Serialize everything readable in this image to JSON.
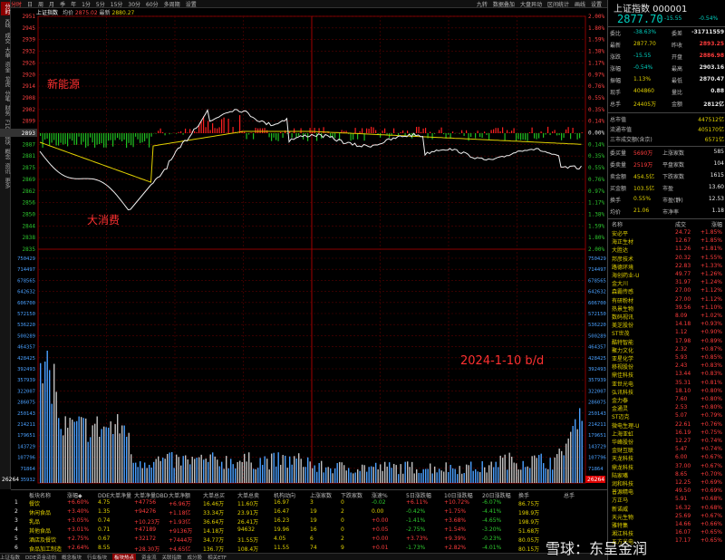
{
  "left_tabs": [
    "分时",
    "K线",
    "成交",
    "大单",
    "资金",
    "龙虎",
    "分笔",
    "财务",
    "F10",
    "板块",
    "概念",
    "资讯",
    "更多"
  ],
  "toolbar": {
    "items": [
      "分时",
      "日",
      "周",
      "月",
      "季",
      "年",
      "1分",
      "5分",
      "15分",
      "30分",
      "60分",
      "多周期",
      "设置"
    ],
    "right_items": [
      "九转",
      "数据叠加",
      "大盘异动",
      "区间统计",
      "画线",
      "设置"
    ],
    "selected": "分时"
  },
  "chart_head": {
    "name": "上证指数",
    "label": "均价",
    "price": "2875.02",
    "label2": "最新",
    "price2": "2880.27"
  },
  "price_axis": {
    "left": [
      "2951",
      "2945",
      "2939",
      "2932",
      "2926",
      "2920",
      "2914",
      "2908",
      "2902",
      "2899",
      "2893",
      "2887",
      "2881",
      "2875",
      "2869",
      "2862",
      "2856",
      "2850",
      "2844",
      "2838",
      "2835"
    ],
    "right": [
      "2.00%",
      "1.80%",
      "1.59%",
      "1.38%",
      "1.17%",
      "0.97%",
      "0.76%",
      "0.55%",
      "0.35%",
      "0.14%",
      "0.00%",
      "0.14%",
      "0.35%",
      "0.55%",
      "0.76%",
      "0.97%",
      "1.17%",
      "1.38%",
      "1.59%",
      "1.80%",
      "2.00%"
    ],
    "ref": "2893"
  },
  "vol_axis": [
    "750429",
    "714497",
    "678565",
    "642632",
    "606700",
    "572150",
    "536220",
    "500289",
    "464357",
    "428425",
    "392493",
    "357939",
    "322007",
    "286075",
    "250143",
    "214211",
    "179651",
    "143729",
    "107796",
    "71864",
    "35932"
  ],
  "annotations": {
    "a1": "新能源",
    "a2": "大消费",
    "a3": "2024-1-10 b/d"
  },
  "volume_tag": "26264",
  "right_panel": {
    "title": "上证指数 000001",
    "price": "2877.70",
    "change": "-15.55",
    "pct": "-0.54%",
    "rows": [
      {
        "l": "委比",
        "v": "-38.63%",
        "l2": "委差",
        "v2": "-31711559"
      },
      {
        "l": "最新",
        "v": "2877.70",
        "l2": "昨收",
        "v2": "2893.25"
      },
      {
        "l": "涨跌",
        "v": "-15.55",
        "l2": "开盘",
        "v2": "2886.98"
      },
      {
        "l": "涨幅",
        "v": "-0.54%",
        "l2": "最高",
        "v2": "2903.16"
      },
      {
        "l": "振幅",
        "v": "1.13%",
        "l2": "最低",
        "v2": "2870.47"
      },
      {
        "l": "现手",
        "v": "404860",
        "l2": "量比",
        "v2": "0.88"
      },
      {
        "l": "总手",
        "v": "24405万",
        "l2": "金额",
        "v2": "2812亿"
      }
    ],
    "rows2": [
      {
        "l": "总市值",
        "v": "447512亿"
      },
      {
        "l": "流通市值",
        "v": "405170亿"
      },
      {
        "l": "三市成交额(含京)",
        "v": "6571亿"
      }
    ],
    "rows3": [
      {
        "l": "委买量",
        "v": "5690万",
        "l2": "上涨家数",
        "v2": "585"
      },
      {
        "l": "委卖量",
        "v": "2519万",
        "l2": "平盘家数",
        "v2": "104"
      },
      {
        "l": "卖金额",
        "v": "454.5亿",
        "l2": "下跌家数",
        "v2": "1615"
      },
      {
        "l": "买金额",
        "v": "103.5亿",
        "l2": "市盈",
        "v2": "13.60"
      },
      {
        "l": "换手",
        "v": "0.55%",
        "l2": "市盈(静)",
        "v2": "12.53"
      },
      {
        "l": "均价",
        "v": "21.06",
        "l2": "市净率",
        "v2": "1.18"
      }
    ],
    "stock_head": {
      "name": "名称",
      "price": "成交",
      "pct": "涨幅"
    },
    "stocks": [
      {
        "n": "安必平",
        "p": "24.72",
        "c": "+1.85%"
      },
      {
        "n": "海正生材",
        "p": "12.67",
        "c": "+1.85%"
      },
      {
        "n": "大胜达",
        "p": "11.26",
        "c": "+1.81%"
      },
      {
        "n": "邦彦技术",
        "p": "20.32",
        "c": "+1.55%"
      },
      {
        "n": "路德环境",
        "p": "22.83",
        "c": "+1.33%"
      },
      {
        "n": "海创药业-U",
        "p": "49.77",
        "c": "+1.26%"
      },
      {
        "n": "金大川",
        "p": "31.97",
        "c": "+1.24%"
      },
      {
        "n": "森霸传感",
        "p": "27.00",
        "c": "+1.12%"
      },
      {
        "n": "有研粉材",
        "p": "27.00",
        "c": "+1.12%"
      },
      {
        "n": "热景生物",
        "p": "39.56",
        "c": "+1.10%"
      },
      {
        "n": "数码视讯",
        "p": "8.09",
        "c": "+1.02%"
      },
      {
        "n": "美芝股份",
        "p": "14.18",
        "c": "+0.93%"
      },
      {
        "n": "ST世茂",
        "p": "1.12",
        "c": "+0.90%"
      },
      {
        "n": "酷特智能",
        "p": "17.98",
        "c": "+0.89%"
      },
      {
        "n": "聚力文化",
        "p": "2.32",
        "c": "+0.87%"
      },
      {
        "n": "亚星化学",
        "p": "5.93",
        "c": "+0.85%"
      },
      {
        "n": "移视股份",
        "p": "2.43",
        "c": "+0.83%"
      },
      {
        "n": "鼎佳科技",
        "p": "13.44",
        "c": "+0.83%"
      },
      {
        "n": "亚世光电",
        "p": "35.31",
        "c": "+0.81%"
      },
      {
        "n": "弘讯科技",
        "p": "18.10",
        "c": "+0.80%"
      },
      {
        "n": "金力泰",
        "p": "7.60",
        "c": "+0.80%"
      },
      {
        "n": "金通灵",
        "p": "2.53",
        "c": "+0.80%"
      },
      {
        "n": "ST迈克",
        "p": "5.07",
        "c": "+0.79%"
      },
      {
        "n": "微电生理-U",
        "p": "22.61",
        "c": "+0.76%"
      },
      {
        "n": "上海亚虹",
        "p": "16.19",
        "c": "+0.75%"
      },
      {
        "n": "华峰股份",
        "p": "12.27",
        "c": "+0.74%"
      },
      {
        "n": "金财互联",
        "p": "5.47",
        "c": "+0.74%"
      },
      {
        "n": "天龙科技",
        "p": "6.00",
        "c": "+0.67%"
      },
      {
        "n": "鼎龙科技",
        "p": "37.00",
        "c": "+0.67%"
      },
      {
        "n": "陆家嘴",
        "p": "8.65",
        "c": "+0.70%"
      },
      {
        "n": "润和科技",
        "p": "12.25",
        "c": "+0.69%"
      },
      {
        "n": "普源精电",
        "p": "49.50",
        "c": "+0.69%"
      },
      {
        "n": "方正马",
        "p": "5.91",
        "c": "+0.68%"
      },
      {
        "n": "新诺威",
        "p": "16.32",
        "c": "+0.68%"
      },
      {
        "n": "天元生物",
        "p": "25.69",
        "c": "+0.67%"
      },
      {
        "n": "雅特集",
        "p": "14.66",
        "c": "+0.66%"
      },
      {
        "n": "湘江科技",
        "p": "16.07",
        "c": "+0.65%"
      },
      {
        "n": "五方光电",
        "p": "17.17",
        "c": "+0.65%"
      }
    ]
  },
  "table": {
    "headers": [
      "板块名称",
      "涨幅◆",
      "DDE大单净量",
      "大单净量DBD",
      "大单净额",
      "大单总买",
      "大单总卖",
      "机构动向",
      "上涨家数",
      "下跌家数",
      "涨速%",
      "5日涨跌幅",
      "10日涨跌幅",
      "20日涨跌幅",
      "换手",
      "总手"
    ],
    "rows": [
      [
        "1",
        "餐饮",
        "+6.60%",
        "4.75",
        "+47756",
        "+6.96万",
        "16.46万",
        "11.60万",
        "16.97",
        "3",
        "0",
        "-0.02",
        "+6.11%",
        "+10.72%",
        "-6.07%",
        "86.75万"
      ],
      [
        "2",
        "休闲食品",
        "+3.40%",
        "1.35",
        "+94276",
        "+1.18亿",
        "33.34万",
        "23.91万",
        "16.47",
        "19",
        "2",
        "0.00",
        "-0.42%",
        "+1.75%",
        "-4.41%",
        "198.9万"
      ],
      [
        "3",
        "乳品",
        "+3.05%",
        "0.74",
        "+10.23万",
        "+1.93亿",
        "36.64万",
        "26.41万",
        "16.23",
        "19",
        "0",
        "+0.00",
        "-1.41%",
        "+3.68%",
        "-4.65%",
        "198.9万"
      ],
      [
        "4",
        "其他食品",
        "+3.01%",
        "0.71",
        "+47189",
        "+9136万",
        "14.18万",
        "94632",
        "19.96",
        "16",
        "0",
        "+0.05",
        "-2.75%",
        "+1.54%",
        "-3.20%",
        "51.68万"
      ],
      [
        "5",
        "酒店及餐饮",
        "+2.75%",
        "0.67",
        "+32172",
        "+7444万",
        "34.77万",
        "31.55万",
        "4.05",
        "6",
        "2",
        "+0.00",
        "+3.73%",
        "+9.39%",
        "-0.23%",
        "80.05万"
      ],
      [
        "6",
        "食品加工制造",
        "+2.64%",
        "8.55",
        "+28.30万",
        "+4.65亿",
        "136.7万",
        "108.4万",
        "11.55",
        "74",
        "9",
        "+0.01",
        "-1.73%",
        "+2.82%",
        "-4.01%",
        "80.15万"
      ]
    ]
  },
  "bottom_tabs": [
    "上证指数",
    "DDE资金动向",
    "概念板块",
    "行业板块",
    "板块热点",
    "资金流",
    "关联指数",
    "成分股",
    "相关ETF"
  ],
  "bottom_tab_selected": "板块热点",
  "watermark": "雪球：东呈金润"
}
